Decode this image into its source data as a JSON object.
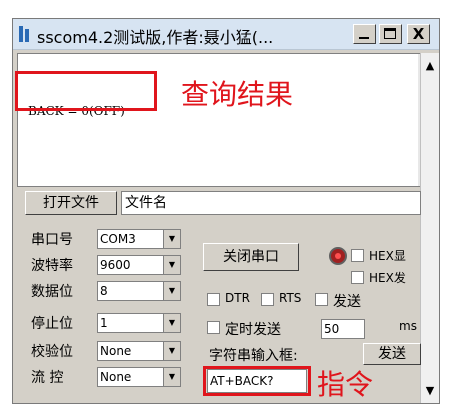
{
  "window": {
    "title": "sscom4.2测试版,作者:聂小猛(...",
    "min_label": "_",
    "close_label": "X"
  },
  "receive": {
    "text": "BACK = 0(OFF)",
    "annotation": "查询结果",
    "scroll_up": "▲",
    "scroll_down": "▼"
  },
  "file": {
    "open_button": "打开文件",
    "filename_field": "文件名"
  },
  "settings": {
    "port_label": "串口号",
    "port_value": "COM3",
    "baud_label": "波特率",
    "baud_value": "9600",
    "databits_label": "数据位",
    "databits_value": "8",
    "stopbits_label": "停止位",
    "stopbits_value": "1",
    "parity_label": "校验位",
    "parity_value": "None",
    "flow_label": "流 控",
    "flow_value": "None",
    "dropdown_arrow": "▼"
  },
  "controls": {
    "close_port_button": "关闭串口",
    "hex_display": "HEX显",
    "hex_send": "HEX发",
    "dtr": "DTR",
    "rts": "RTS",
    "send_newline": "发送",
    "timed_send": "定时发送",
    "interval_value": "50",
    "interval_unit": "ms",
    "string_input_label": "字符串输入框:",
    "send_button": "发送",
    "command_text": "AT+BACK?",
    "command_annotation": "指令"
  },
  "colors": {
    "annotation_red": "#e0151c",
    "window_bg": "#d4d0c8"
  }
}
